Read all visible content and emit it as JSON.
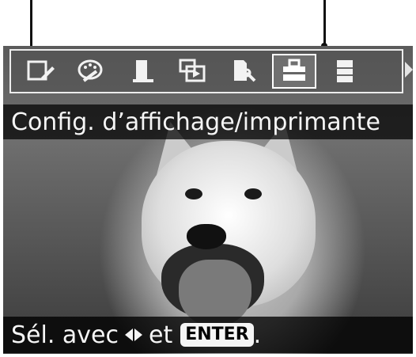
{
  "top_text": "",
  "toolbar": {
    "items": [
      {
        "icon": "edit-icon"
      },
      {
        "icon": "palette-icon"
      },
      {
        "icon": "document-icon"
      },
      {
        "icon": "slideshow-icon"
      },
      {
        "icon": "file-tools-icon"
      },
      {
        "icon": "toolbox-icon"
      },
      {
        "icon": "cabinet-icon"
      }
    ],
    "selected_index": 5
  },
  "title_bar": {
    "text": "Config. d’affichage/imprimante"
  },
  "status_bar": {
    "prefix": "Sél. avec",
    "middle": "et",
    "enter_label": "ENTER",
    "suffix": "."
  }
}
